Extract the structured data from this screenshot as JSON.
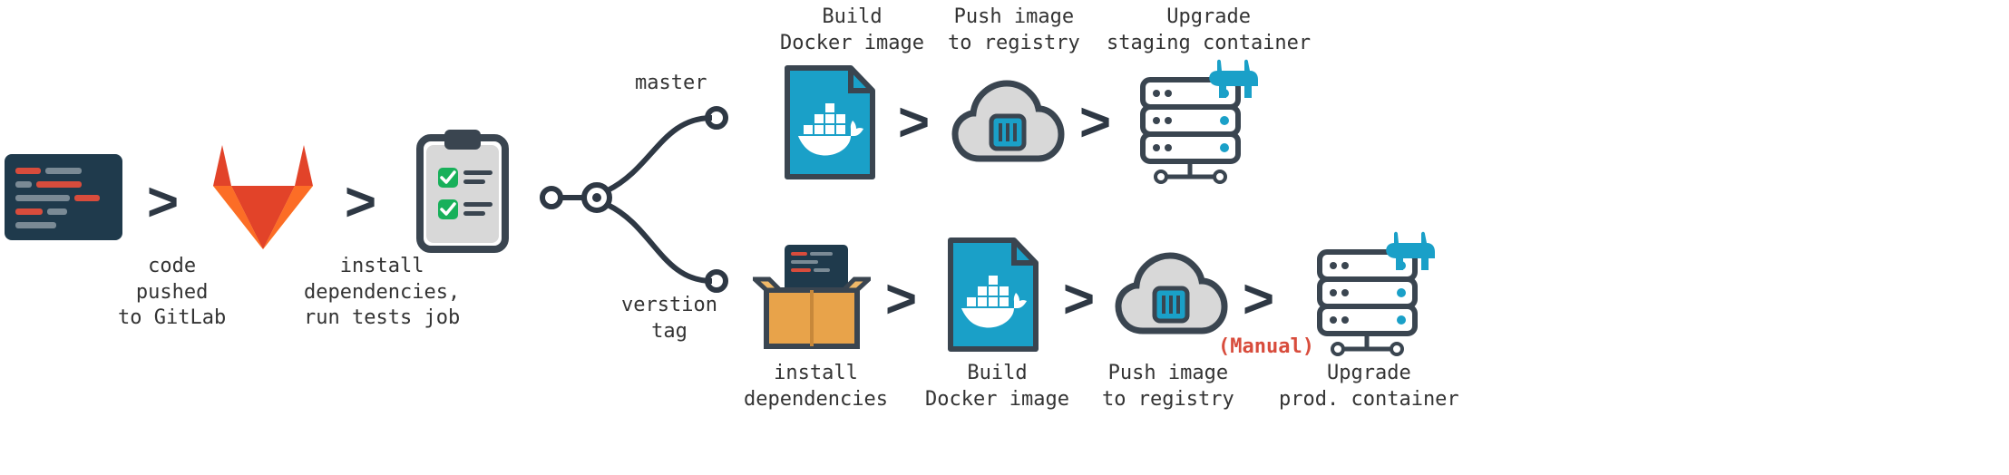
{
  "labels": {
    "code_pushed": "code\npushed\nto GitLab",
    "install_deps_tests": "install\ndependencies,\nrun tests job",
    "branch_master": "master",
    "branch_tag": "verstion\ntag",
    "master_build": "Build\nDocker image",
    "master_push": "Push image\nto registry",
    "master_upgrade": "Upgrade\nstaging container",
    "tag_install": "install\ndependencies",
    "tag_build": "Build\nDocker image",
    "tag_push": "Push image\nto registry",
    "tag_upgrade": "Upgrade\nprod. container",
    "manual": "(Manual)"
  }
}
